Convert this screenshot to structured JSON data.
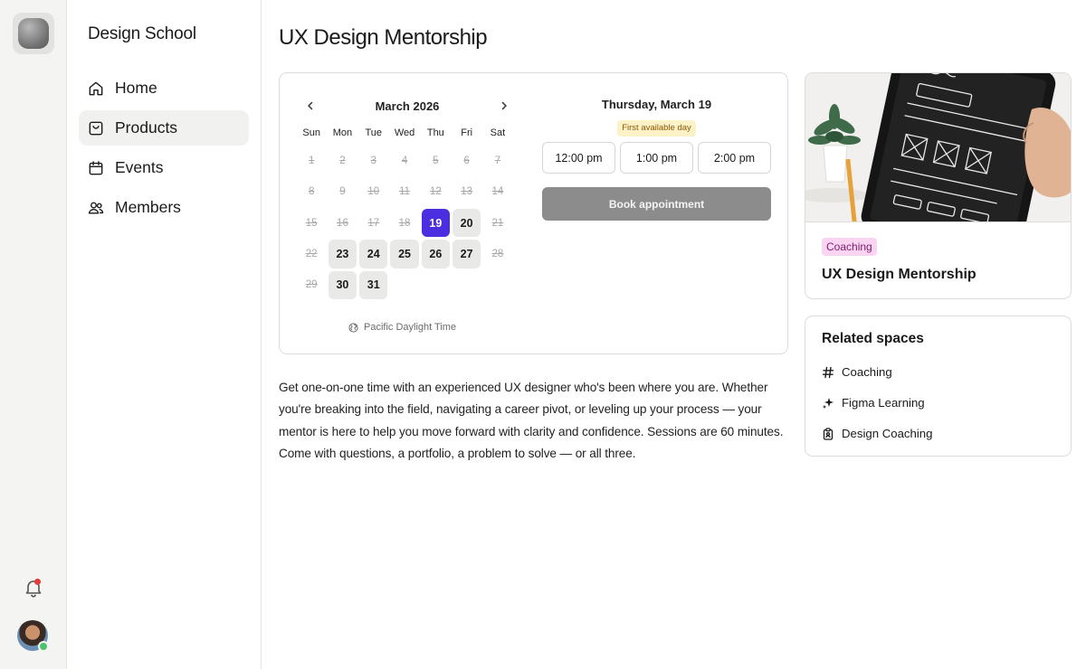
{
  "sidebar": {
    "brand": "Design School",
    "items": [
      {
        "label": "Home",
        "icon": "home-icon"
      },
      {
        "label": "Products",
        "icon": "bag-icon"
      },
      {
        "label": "Events",
        "icon": "calendar-icon"
      },
      {
        "label": "Members",
        "icon": "members-icon"
      }
    ],
    "active": "Products"
  },
  "page": {
    "title": "UX Design Mentorship"
  },
  "calendar": {
    "month_label": "March 2026",
    "weekdays": [
      "Sun",
      "Mon",
      "Tue",
      "Wed",
      "Thu",
      "Fri",
      "Sat"
    ],
    "leading_blanks": 0,
    "days_in_month": 31,
    "available_days": [
      20,
      23,
      24,
      25,
      26,
      27,
      30,
      31
    ],
    "selected_day": 19,
    "timezone": "Pacific Daylight Time",
    "accent_color": "#4a2ee0"
  },
  "slots": {
    "date_label": "Thursday, March 19",
    "badge": "First available day",
    "times": [
      "12:00 pm",
      "1:00 pm",
      "2:00 pm"
    ],
    "book_label": "Book appointment"
  },
  "description": "Get one-on-one time with an experienced UX designer who's been where you are. Whether you're breaking into the field, navigating a career pivot, or leveling up your process — your mentor is here to help you move forward with clarity and confidence. Sessions are 60 minutes. Come with questions, a portfolio, a problem to solve — or all three.",
  "product_card": {
    "tag": "Coaching",
    "title": "UX Design Mentorship",
    "tag_color": "#fbd4f4"
  },
  "related": {
    "title": "Related spaces",
    "items": [
      {
        "label": "Coaching",
        "icon": "hash-icon"
      },
      {
        "label": "Figma Learning",
        "icon": "sparkle-icon"
      },
      {
        "label": "Design Coaching",
        "icon": "clipboard-icon"
      }
    ]
  }
}
